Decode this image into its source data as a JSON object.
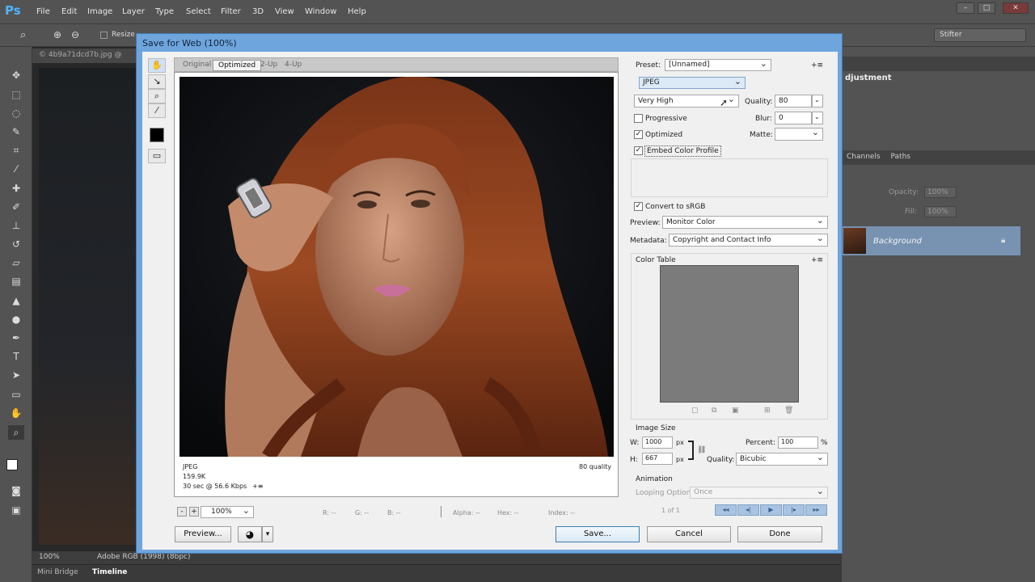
{
  "app": {
    "logo": "Ps",
    "menu": [
      "File",
      "Edit",
      "Image",
      "Layer",
      "Type",
      "Select",
      "Filter",
      "3D",
      "View",
      "Window",
      "Help"
    ],
    "window_controls": [
      "–",
      "□",
      "✕"
    ],
    "options_bar": {
      "resize_label": "Resize"
    },
    "workspace": "Stifter",
    "document_tab": "© 4b9a71dcd7b.jpg @",
    "status": {
      "zoom": "100%",
      "profile": "Adobe RGB (1998) (8bpc)"
    },
    "bottom_tabs": [
      "Mini Bridge",
      "Timeline"
    ],
    "panels": {
      "adjustments_title": "djustment",
      "layers_tabs": [
        "Channels",
        "Paths"
      ],
      "opacity_label": "Opacity:",
      "opacity_value": "100%",
      "fill_label": "Fill:",
      "fill_value": "100%",
      "layer_name": "Background"
    }
  },
  "dialog": {
    "title": "Save for Web (100%)",
    "view_tabs": [
      "Original",
      "Optimized",
      "2-Up",
      "4-Up"
    ],
    "active_tab": "Optimized",
    "info_left": [
      "JPEG",
      "159.9K",
      "30 sec @ 56.6 Kbps"
    ],
    "info_menu": "+≡",
    "info_right": "80 quality",
    "zoom": {
      "minus": "-",
      "plus": "+",
      "value": "100%"
    },
    "readouts": {
      "r": "R: --",
      "g": "G: --",
      "b": "B: --",
      "alpha": "Alpha: --",
      "hex": "Hex: --",
      "index": "Index: --"
    },
    "preview_button": "Preview...",
    "preset": {
      "label": "Preset:",
      "value": "[Unnamed]",
      "menu": "+≡"
    },
    "format": "JPEG",
    "quality_preset": "Very High",
    "quality": {
      "label": "Quality:",
      "value": "80"
    },
    "blur": {
      "label": "Blur:",
      "value": "0"
    },
    "matte": {
      "label": "Matte:",
      "value": ""
    },
    "checkboxes": {
      "progressive": {
        "label": "Progressive",
        "checked": false
      },
      "optimized": {
        "label": "Optimized",
        "checked": true
      },
      "embed_profile": {
        "label": "Embed Color Profile",
        "checked": true
      },
      "convert_srgb": {
        "label": "Convert to sRGB",
        "checked": true
      }
    },
    "preview_select": {
      "label": "Preview:",
      "value": "Monitor Color"
    },
    "metadata_select": {
      "label": "Metadata:",
      "value": "Copyright and Contact Info"
    },
    "color_table": {
      "title": "Color Table",
      "menu": "+≡"
    },
    "image_size": {
      "title": "Image Size",
      "w_label": "W:",
      "w_value": "1000",
      "h_label": "H:",
      "h_value": "667",
      "unit": "px",
      "percent_label": "Percent:",
      "percent_value": "100",
      "percent_unit": "%",
      "quality_label": "Quality:",
      "quality_value": "Bicubic"
    },
    "animation": {
      "title": "Animation",
      "looping_label": "Looping Options:",
      "looping_value": "Once",
      "frame_counter": "1 of 1",
      "controls": [
        "◂◂",
        "◂|",
        "▶",
        "|▸",
        "▸▸"
      ]
    },
    "buttons": {
      "save": "Save...",
      "cancel": "Cancel",
      "done": "Done"
    },
    "colors": {
      "title_bar": "#6fa5dd",
      "body": "#f0f0f0",
      "selection": "#7892b2"
    }
  }
}
